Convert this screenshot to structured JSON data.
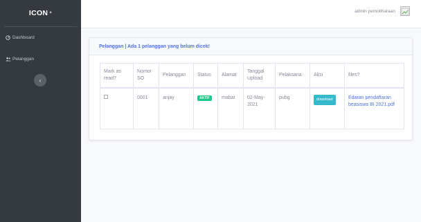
{
  "sidebar": {
    "brand": "ICON",
    "brand_mark": "+",
    "items": [
      {
        "label": "Dashboard",
        "icon": "dashboard-icon"
      },
      {
        "label": "Pelanggan",
        "icon": "users-icon"
      }
    ],
    "toggle_icon": "chevron-left-icon"
  },
  "topbar": {
    "user_name": "admin pemoliharaan"
  },
  "card": {
    "title": "Pelanggan | Ada 1 pelanggan yang belum dicek!"
  },
  "table": {
    "headers": {
      "mark": "Mark as read?",
      "nomor": "Nomor SO",
      "pelanggan": "Pelanggan",
      "status": "Status",
      "alamat": "Alamat",
      "tanggal": "Tanggal Upload",
      "pelaksana": "Pelaksana",
      "aksi": "Aksi",
      "files": "files?"
    },
    "rows": [
      {
        "nomor": "0001",
        "pelanggan": "anjay",
        "status": "AKTIF",
        "alamat": "mabar",
        "tanggal": "02-May-2021",
        "pelaksana": "pubg",
        "aksi": "download",
        "file": "Edaran pendaftaran beasiswa BI 2021.pdf"
      }
    ]
  },
  "colors": {
    "sidebar": "#343a40",
    "primary": "#4e73df",
    "success": "#1cc88a",
    "info": "#36b9cc"
  }
}
